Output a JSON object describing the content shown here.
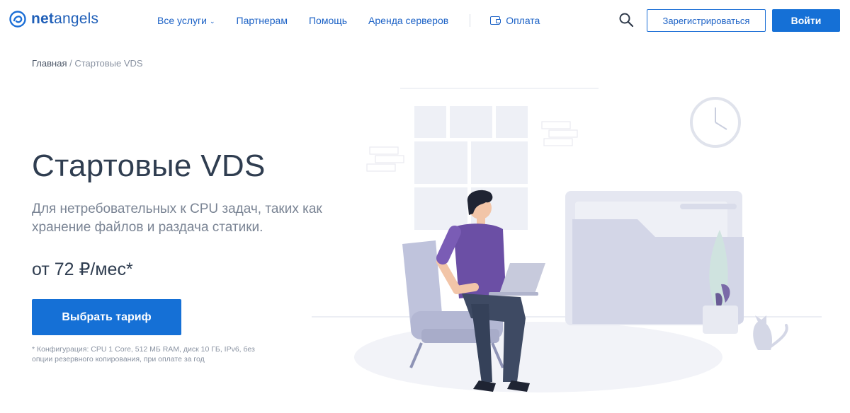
{
  "header": {
    "logo_text_bold": "net",
    "logo_text_rest": "angels",
    "nav": [
      {
        "label": "Все услуги",
        "has_dropdown": true
      },
      {
        "label": "Партнерам"
      },
      {
        "label": "Помощь"
      },
      {
        "label": "Аренда серверов"
      }
    ],
    "pay_label": "Оплата",
    "register_label": "Зарегистрироваться",
    "login_label": "Войти",
    "icons": {
      "search": "search-icon",
      "pay": "wallet-icon",
      "logo": "netangels-logo-icon"
    }
  },
  "breadcrumb": {
    "home": "Главная",
    "separator": " / ",
    "current": "Стартовые VDS"
  },
  "hero": {
    "title": "Стартовые VDS",
    "subtitle": "Для нетребовательных к CPU задач, таких как хранение файлов и  раздача статики.",
    "price": "от 72 ₽/мес*",
    "cta_label": "Выбрать тариф",
    "footnote": "* Конфигурация: CPU 1 Core, 512 МБ RAM, диск 10 ГБ, IPv6, без опции резервного копирования, при оплате за год"
  },
  "colors": {
    "brand_blue": "#1570d6",
    "link_blue": "#1c62c6",
    "title_dark": "#2f3d50",
    "muted": "#7a8494"
  }
}
